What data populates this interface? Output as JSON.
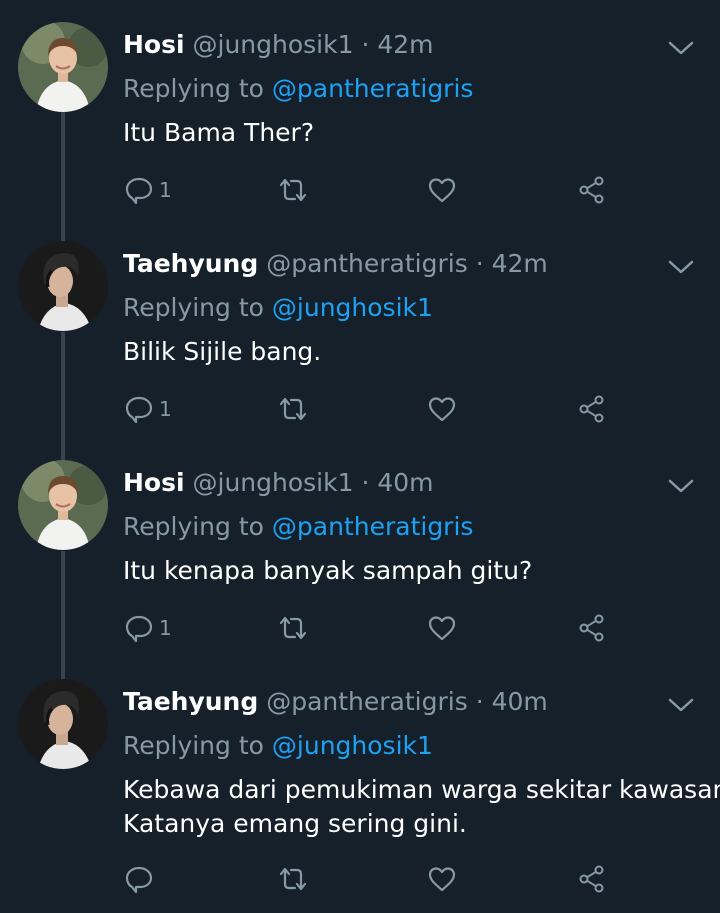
{
  "tweets": [
    {
      "name": "Hosi",
      "handle": "@junghosik1",
      "separator": "·",
      "time": "42m",
      "replying_prefix": "Replying to",
      "replying_to": "@pantheratigris",
      "text_lines": [
        "Itu Bama Ther?"
      ],
      "reply_count": "1",
      "avatar": "hosi"
    },
    {
      "name": "Taehyung",
      "handle": "@pantheratigris",
      "separator": "·",
      "time": "42m",
      "replying_prefix": "Replying to",
      "replying_to": "@junghosik1",
      "text_lines": [
        "Bilik Sijile bang."
      ],
      "reply_count": "1",
      "avatar": "taehyung"
    },
    {
      "name": "Hosi",
      "handle": "@junghosik1",
      "separator": "·",
      "time": "40m",
      "replying_prefix": "Replying to",
      "replying_to": "@pantheratigris",
      "text_lines": [
        "Itu kenapa banyak sampah gitu?"
      ],
      "reply_count": "1",
      "avatar": "hosi"
    },
    {
      "name": "Taehyung",
      "handle": "@pantheratigris",
      "separator": "·",
      "time": "40m",
      "replying_prefix": "Replying to",
      "replying_to": "@junghosik1",
      "text_lines": [
        "Kebawa dari pemukiman warga sekitar kawasan.",
        "Katanya emang sering gini."
      ],
      "reply_count": "",
      "avatar": "taehyung"
    }
  ],
  "icons": {
    "reply": "reply-icon",
    "retweet": "retweet-icon",
    "like": "heart-icon",
    "share": "share-icon",
    "menu": "chevron-down-icon"
  },
  "colors": {
    "background": "#15202b",
    "secondary_text": "#8899a6",
    "link": "#1da1f2",
    "thread_line": "#38444d"
  }
}
